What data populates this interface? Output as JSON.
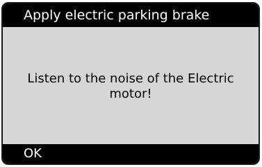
{
  "screen": {
    "title": "Apply electric parking brake",
    "message": "Listen to the noise of the Electric motor!",
    "ok_label": "OK"
  },
  "colors": {
    "bar_background": "#000000",
    "bar_text": "#ffffff",
    "screen_background": "#d6d6d6",
    "message_text": "#000000"
  }
}
